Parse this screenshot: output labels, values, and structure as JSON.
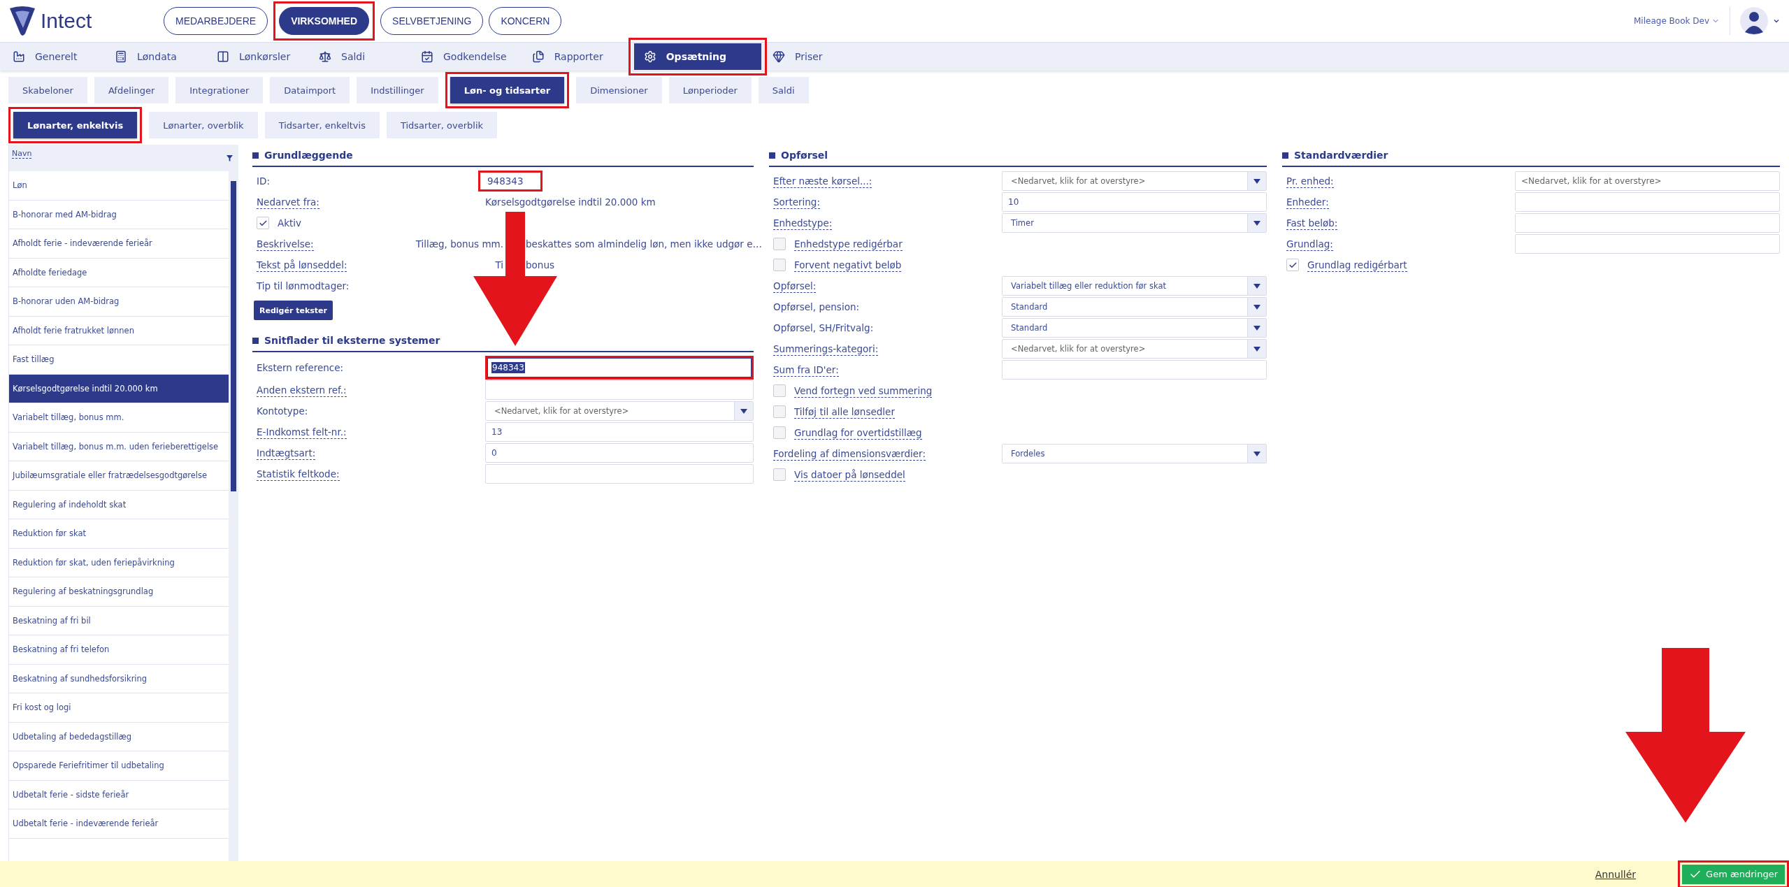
{
  "header": {
    "logo_text": "Intect",
    "top_tabs": [
      {
        "label": "MEDARBEJDERE",
        "selected": false,
        "highlighted": false
      },
      {
        "label": "VIRKSOMHED",
        "selected": true,
        "highlighted": true
      },
      {
        "label": "SELVBETJENING",
        "selected": false,
        "highlighted": false
      },
      {
        "label": "KONCERN",
        "selected": false,
        "highlighted": false
      }
    ],
    "company": "Mileage Book Dev"
  },
  "nav": [
    {
      "label": "Generelt",
      "selected": false,
      "highlighted": false
    },
    {
      "label": "Løndata",
      "selected": false,
      "highlighted": false
    },
    {
      "label": "Lønkørsler",
      "selected": false,
      "highlighted": false
    },
    {
      "label": "Saldi",
      "selected": false,
      "highlighted": false
    },
    {
      "label": "Godkendelse",
      "selected": false,
      "highlighted": false
    },
    {
      "label": "Rapporter",
      "selected": false,
      "highlighted": false
    },
    {
      "label": "Opsætning",
      "selected": true,
      "highlighted": true
    },
    {
      "label": "Priser",
      "selected": false,
      "highlighted": false
    }
  ],
  "subtabs": [
    {
      "label": "Skabeloner",
      "selected": false,
      "highlighted": false
    },
    {
      "label": "Afdelinger",
      "selected": false,
      "highlighted": false
    },
    {
      "label": "Integrationer",
      "selected": false,
      "highlighted": false
    },
    {
      "label": "Dataimport",
      "selected": false,
      "highlighted": false
    },
    {
      "label": "Indstillinger",
      "selected": false,
      "highlighted": false
    },
    {
      "label": "Løn- og tidsarter",
      "selected": true,
      "highlighted": true
    },
    {
      "label": "Dimensioner",
      "selected": false,
      "highlighted": false
    },
    {
      "label": "Lønperioder",
      "selected": false,
      "highlighted": false
    },
    {
      "label": "Saldi",
      "selected": false,
      "highlighted": false
    }
  ],
  "subsubtabs": [
    {
      "label": "Lønarter, enkeltvis",
      "selected": true,
      "highlighted": true
    },
    {
      "label": "Lønarter, overblik",
      "selected": false,
      "highlighted": false
    },
    {
      "label": "Tidsarter, enkeltvis",
      "selected": false,
      "highlighted": false
    },
    {
      "label": "Tidsarter, overblik",
      "selected": false,
      "highlighted": false
    }
  ],
  "list": {
    "column": "Navn",
    "items": [
      {
        "label": "Løn",
        "selected": false
      },
      {
        "label": "B-honorar med AM-bidrag",
        "selected": false
      },
      {
        "label": "Afholdt ferie - indeværende ferieår",
        "selected": false
      },
      {
        "label": "Afholdte feriedage",
        "selected": false
      },
      {
        "label": "B-honorar uden AM-bidrag",
        "selected": false
      },
      {
        "label": "Afholdt ferie fratrukket lønnen",
        "selected": false
      },
      {
        "label": "Fast tillæg",
        "selected": false
      },
      {
        "label": "Kørselsgodtgørelse indtil 20.000 km",
        "selected": true
      },
      {
        "label": "Variabelt tillæg, bonus mm.",
        "selected": false
      },
      {
        "label": "Variabelt tillæg, bonus m.m. uden ferieberettigelse",
        "selected": false
      },
      {
        "label": "Jubilæumsgratiale eller fratrædelsesgodtgørelse",
        "selected": false
      },
      {
        "label": "Regulering af indeholdt skat",
        "selected": false
      },
      {
        "label": "Reduktion før skat",
        "selected": false
      },
      {
        "label": "Reduktion før skat, uden feriepåvirkning",
        "selected": false
      },
      {
        "label": "Regulering af beskatningsgrundlag",
        "selected": false
      },
      {
        "label": "Beskatning af fri bil",
        "selected": false
      },
      {
        "label": "Beskatning af fri telefon",
        "selected": false
      },
      {
        "label": "Beskatning af sundhedsforsikring",
        "selected": false
      },
      {
        "label": "Fri kost og logi",
        "selected": false
      },
      {
        "label": "Udbetaling af bededagstillæg",
        "selected": false
      },
      {
        "label": "Opsparede Feriefritimer til udbetaling",
        "selected": false
      },
      {
        "label": "Udbetalt ferie - sidste ferieår",
        "selected": false
      },
      {
        "label": "Udbetalt ferie - indeværende ferieår",
        "selected": false
      }
    ]
  },
  "columns": [
    {
      "sections": [
        {
          "title": "Grundlæggende",
          "rows": [
            {
              "kind": "text",
              "label": "ID:",
              "hint": false,
              "value": "948343",
              "highlighted": true
            },
            {
              "kind": "text",
              "label": "Nedarvet fra:",
              "hint": true,
              "value": "Kørselsgodtgørelse indtil 20.000 km"
            },
            {
              "kind": "checkbox",
              "label": "Aktiv",
              "hint": false,
              "checked": true
            },
            {
              "kind": "split",
              "label": "Beskrivelse:",
              "hint": true,
              "value_parts": [
                "Tillæg, bonus mm.",
                "beskattes som almindelig løn, men ikke udgør e…"
              ]
            },
            {
              "kind": "split",
              "label": "Tekst på lønseddel:",
              "hint": true,
              "value_parts": [
                "Ti",
                "bonus"
              ]
            },
            {
              "kind": "text",
              "label": "Tip til lønmodtager:",
              "hint": false
            },
            {
              "kind": "button",
              "label": "Redigér tekster"
            }
          ]
        },
        {
          "title": "Snitflader til eksterne systemer",
          "rows": [
            {
              "kind": "input",
              "label": "Ekstern reference:",
              "hint": false,
              "value": "948343",
              "text_selected": true,
              "highlighted": true
            },
            {
              "kind": "input",
              "label": "Anden ekstern ref.:",
              "hint": true
            },
            {
              "kind": "select",
              "label": "Kontotype:",
              "hint": false,
              "placeholder": "<Nedarvet, klik for at overstyre>"
            },
            {
              "kind": "input",
              "label": "E-Indkomst felt-nr.:",
              "hint": true,
              "value": "13"
            },
            {
              "kind": "input",
              "label": "Indtægtsart:",
              "hint": true,
              "value": "0"
            },
            {
              "kind": "input",
              "label": "Statistik feltkode:",
              "hint": true
            }
          ]
        }
      ]
    },
    {
      "sections": [
        {
          "title": "Opførsel",
          "rows": [
            {
              "kind": "select",
              "label": "Efter næste kørsel...:",
              "hint": true,
              "placeholder": "<Nedarvet, klik for at overstyre>"
            },
            {
              "kind": "input",
              "label": "Sortering:",
              "hint": true,
              "value": "10"
            },
            {
              "kind": "select",
              "label": "Enhedstype:",
              "hint": true,
              "value": "Timer"
            },
            {
              "kind": "checkbox",
              "label": "Enhedstype redigérbar",
              "hint": true,
              "checked": false
            },
            {
              "kind": "checkbox",
              "label": "Forvent negativt beløb",
              "hint": true,
              "checked": false
            },
            {
              "kind": "select",
              "label": "Opførsel:",
              "hint": true,
              "value": "Variabelt tillæg eller reduktion før skat"
            },
            {
              "kind": "select",
              "label": "Opførsel, pension:",
              "hint": false,
              "value": "Standard"
            },
            {
              "kind": "select",
              "label": "Opførsel, SH/Fritvalg:",
              "hint": false,
              "value": "Standard"
            },
            {
              "kind": "select",
              "label": "Summerings-kategori:",
              "hint": true,
              "placeholder": "<Nedarvet, klik for at overstyre>"
            },
            {
              "kind": "input",
              "label": "Sum fra ID'er:",
              "hint": true
            },
            {
              "kind": "checkbox",
              "label": "Vend fortegn ved summering",
              "hint": true,
              "checked": false
            },
            {
              "kind": "checkbox",
              "label": "Tilføj til alle lønsedler",
              "hint": true,
              "checked": false
            },
            {
              "kind": "checkbox",
              "label": "Grundlag for overtidstillæg",
              "hint": true,
              "checked": false
            },
            {
              "kind": "select",
              "label": "Fordeling af dimensionsværdier:",
              "hint": true,
              "value": "Fordeles"
            },
            {
              "kind": "checkbox",
              "label": "Vis datoer på lønseddel",
              "hint": true,
              "checked": false
            }
          ]
        }
      ]
    },
    {
      "sections": [
        {
          "title": "Standardværdier",
          "rows": [
            {
              "kind": "input",
              "label": "Pr. enhed:",
              "hint": true,
              "placeholder": "<Nedarvet, klik for at overstyre>"
            },
            {
              "kind": "input",
              "label": "Enheder:",
              "hint": true
            },
            {
              "kind": "input",
              "label": "Fast beløb:",
              "hint": true
            },
            {
              "kind": "input",
              "label": "Grundlag:",
              "hint": true
            },
            {
              "kind": "checkbox",
              "label": "Grundlag redigérbart",
              "hint": true,
              "checked": true
            }
          ]
        }
      ]
    }
  ],
  "footer": {
    "cancel": "Annullér",
    "save": {
      "label": "Gem ændringer",
      "highlighted": true
    }
  }
}
